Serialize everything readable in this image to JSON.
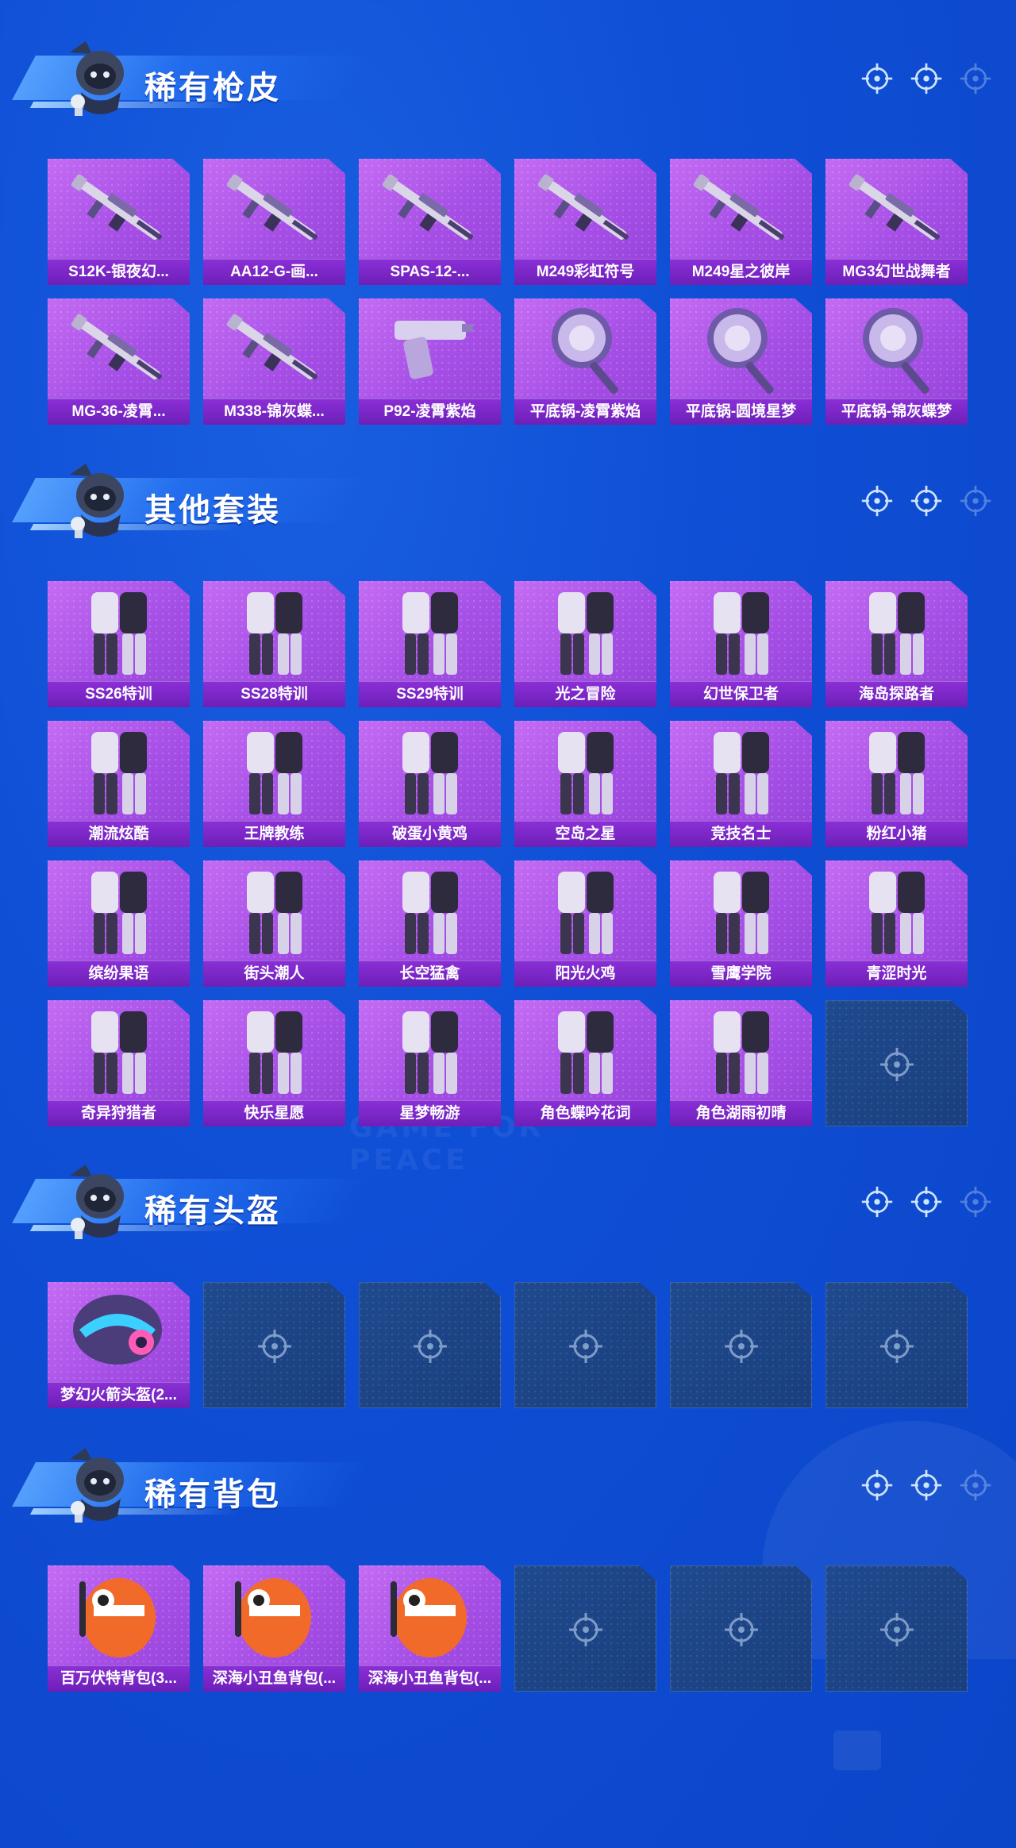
{
  "sections": [
    {
      "title": "稀有枪皮",
      "items": [
        {
          "label": "S12K-银夜幻...",
          "kind": "gun"
        },
        {
          "label": "AA12-G-画...",
          "kind": "gun"
        },
        {
          "label": "SPAS-12-...",
          "kind": "gun"
        },
        {
          "label": "M249彩虹符号",
          "kind": "gun"
        },
        {
          "label": "M249星之彼岸",
          "kind": "gun"
        },
        {
          "label": "MG3幻世战舞者",
          "kind": "gun"
        },
        {
          "label": "MG-36-凌霄...",
          "kind": "gun"
        },
        {
          "label": "M338-锦灰蝶...",
          "kind": "gun"
        },
        {
          "label": "P92-凌霄紫焰",
          "kind": "pistol"
        },
        {
          "label": "平底锅-凌霄紫焰",
          "kind": "pan"
        },
        {
          "label": "平底锅-圆境星梦",
          "kind": "pan"
        },
        {
          "label": "平底锅-锦灰蝶梦",
          "kind": "pan"
        }
      ],
      "empty_slots": 0
    },
    {
      "title": "其他套装",
      "items": [
        {
          "label": "SS26特训",
          "kind": "outfit"
        },
        {
          "label": "SS28特训",
          "kind": "outfit"
        },
        {
          "label": "SS29特训",
          "kind": "outfit"
        },
        {
          "label": "光之冒险",
          "kind": "outfit"
        },
        {
          "label": "幻世保卫者",
          "kind": "outfit"
        },
        {
          "label": "海岛探路者",
          "kind": "outfit"
        },
        {
          "label": "潮流炫酷",
          "kind": "outfit"
        },
        {
          "label": "王牌教练",
          "kind": "outfit"
        },
        {
          "label": "破蛋小黄鸡",
          "kind": "outfit"
        },
        {
          "label": "空岛之星",
          "kind": "outfit"
        },
        {
          "label": "竞技名士",
          "kind": "outfit"
        },
        {
          "label": "粉红小猪",
          "kind": "outfit"
        },
        {
          "label": "缤纷果语",
          "kind": "outfit"
        },
        {
          "label": "街头潮人",
          "kind": "outfit"
        },
        {
          "label": "长空猛禽",
          "kind": "outfit"
        },
        {
          "label": "阳光火鸡",
          "kind": "outfit"
        },
        {
          "label": "雪鹰学院",
          "kind": "outfit"
        },
        {
          "label": "青涩时光",
          "kind": "outfit"
        },
        {
          "label": "奇异狩猎者",
          "kind": "outfit"
        },
        {
          "label": "快乐星愿",
          "kind": "outfit"
        },
        {
          "label": "星梦畅游",
          "kind": "outfit"
        },
        {
          "label": "角色蝶吟花词",
          "kind": "outfit"
        },
        {
          "label": "角色湖雨初晴",
          "kind": "outfit"
        }
      ],
      "empty_slots": 1
    },
    {
      "title": "稀有头盔",
      "items": [
        {
          "label": "梦幻火箭头盔(2...",
          "kind": "helmet"
        }
      ],
      "empty_slots": 5
    },
    {
      "title": "稀有背包",
      "items": [
        {
          "label": "百万伏特背包(3...",
          "kind": "backpack"
        },
        {
          "label": "深海小丑鱼背包(...",
          "kind": "backpack"
        },
        {
          "label": "深海小丑鱼背包(...",
          "kind": "backpack"
        }
      ],
      "empty_slots": 3
    }
  ],
  "watermark": "GAME FOR PEACE",
  "icons": {
    "header_nav": "crosshair-icon",
    "empty_slot": "crosshair-icon",
    "mascot": "mascot-icon"
  },
  "colors": {
    "background": "#0f4fd6",
    "card": "#a64fe6",
    "card_label": "#7a26c6",
    "empty_card": "#1d4585"
  }
}
